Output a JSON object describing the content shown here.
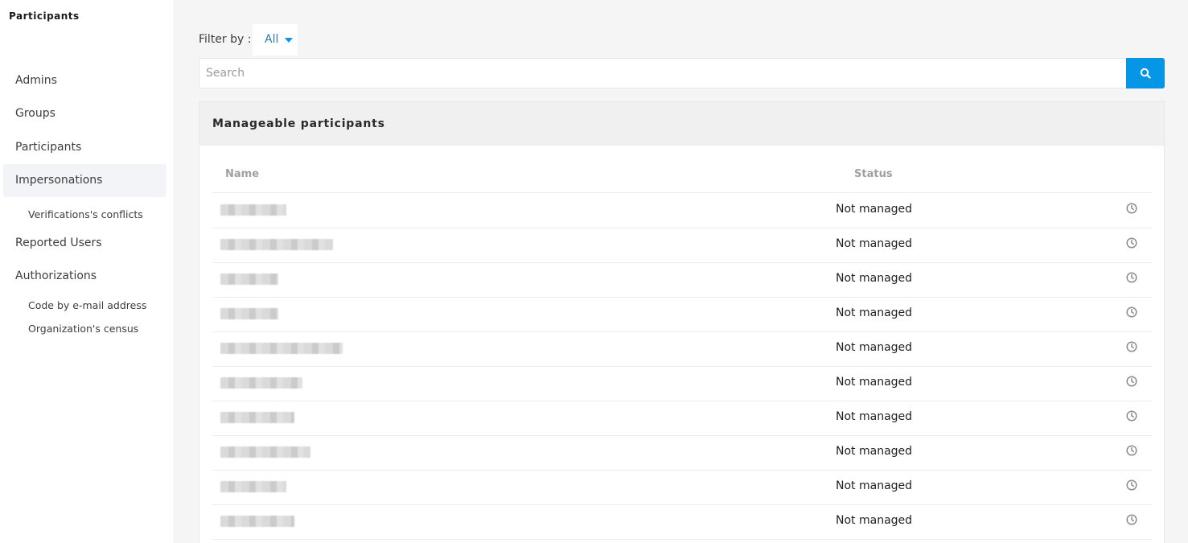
{
  "sidebar": {
    "title": "Participants",
    "items": [
      {
        "label": "Admins"
      },
      {
        "label": "Groups"
      },
      {
        "label": "Participants"
      },
      {
        "label": "Impersonations"
      },
      {
        "label": "Verifications's conflicts"
      },
      {
        "label": "Reported Users"
      },
      {
        "label": "Authorizations"
      },
      {
        "label": "Code by e-mail address"
      },
      {
        "label": "Organization's census"
      }
    ]
  },
  "filter": {
    "label": "Filter by :",
    "selected": "All"
  },
  "search": {
    "placeholder": "Search",
    "value": ""
  },
  "card": {
    "title": "Manageable participants"
  },
  "table": {
    "columns": [
      "Name",
      "Status"
    ],
    "rows": [
      {
        "name": "",
        "status": "Not managed"
      },
      {
        "name": "",
        "status": "Not managed"
      },
      {
        "name": "",
        "status": "Not managed"
      },
      {
        "name": "",
        "status": "Not managed"
      },
      {
        "name": "",
        "status": "Not managed"
      },
      {
        "name": "",
        "status": "Not managed"
      },
      {
        "name": "",
        "status": "Not managed"
      },
      {
        "name": "",
        "status": "Not managed"
      },
      {
        "name": "",
        "status": "Not managed"
      },
      {
        "name": "",
        "status": "Not managed"
      }
    ]
  },
  "icons": {
    "search": "search-icon",
    "row_action": "clock-icon",
    "filter": "caret-down-icon"
  },
  "colors": {
    "accent": "#0596e5",
    "link": "#2c7bb6"
  }
}
